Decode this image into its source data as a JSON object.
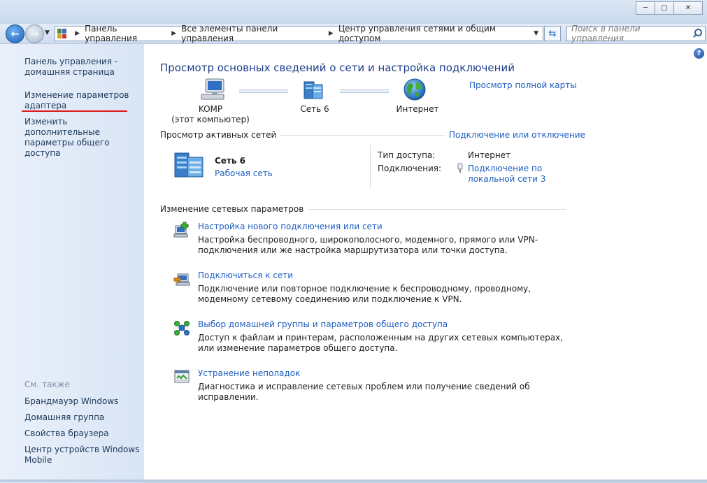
{
  "window": {
    "minimize_label": "─",
    "maximize_label": "▢",
    "close_label": "✕"
  },
  "address": {
    "crumbs": [
      "Панель управления",
      "Все элементы панели управления",
      "Центр управления сетями и общим доступом"
    ]
  },
  "search": {
    "placeholder": "Поиск в панели управления"
  },
  "sidebar": {
    "home": "Панель управления - домашняя страница",
    "adapter": "Изменение параметров адаптера",
    "sharing": "Изменить дополнительные параметры общего доступа",
    "see_also": "См. также",
    "see_also_links": [
      "Брандмауэр Windows",
      "Домашняя группа",
      "Свойства браузера",
      "Центр устройств Windows Mobile"
    ]
  },
  "main": {
    "title": "Просмотр основных сведений о сети и настройка подключений",
    "full_map_link": "Просмотр полной карты",
    "map": {
      "computer_name": "KOMP",
      "computer_sub": "(этот компьютер)",
      "network_name": "Сеть  6",
      "internet_name": "Интернет"
    },
    "active_networks": {
      "title": "Просмотр активных сетей",
      "connect_link": "Подключение или отключение",
      "network_name": "Сеть  6",
      "network_type": "Рабочая сеть",
      "access_type_label": "Тип доступа:",
      "access_type_value": "Интернет",
      "connections_label": "Подключения:",
      "connection_link": "Подключение по локальной сети 3"
    },
    "change_settings": {
      "title": "Изменение сетевых параметров",
      "tasks": [
        {
          "link": "Настройка нового подключения или сети",
          "desc": "Настройка беспроводного, широкополосного, модемного, прямого или VPN-подключения или же настройка маршрутизатора или точки доступа."
        },
        {
          "link": "Подключиться к сети",
          "desc": "Подключение или повторное подключение к беспроводному, проводному, модемному сетевому соединению или подключение к VPN."
        },
        {
          "link": "Выбор домашней группы и параметров общего доступа",
          "desc": "Доступ к файлам и принтерам, расположенным на других сетевых компьютерах, или изменение параметров общего доступа."
        },
        {
          "link": "Устранение неполадок",
          "desc": "Диагностика и исправление сетевых проблем или получение сведений об исправлении."
        }
      ]
    }
  },
  "icons": {
    "back": "back-arrow-icon",
    "forward": "forward-arrow-icon",
    "computer": "computer-icon",
    "network": "network-icon",
    "internet": "globe-icon",
    "help": "help-icon"
  },
  "colors": {
    "link": "#1f5ec2",
    "title": "#1e3d8a",
    "sidebar_bg": "#e1eaf7",
    "highlight_underline": "#e01a1a"
  }
}
